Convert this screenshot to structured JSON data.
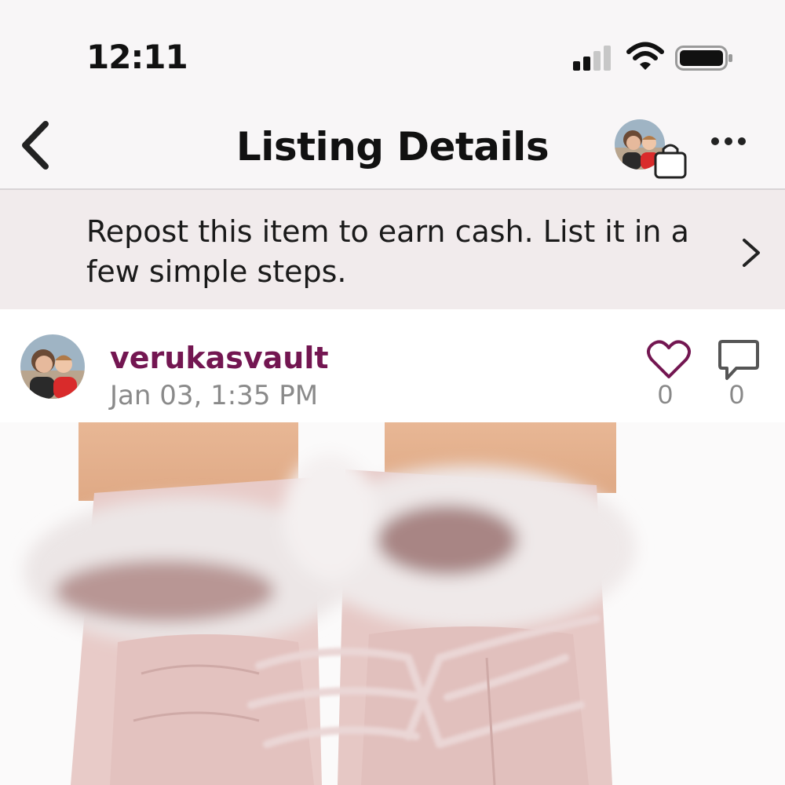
{
  "status_bar": {
    "time": "12:11"
  },
  "nav": {
    "title": "Listing Details"
  },
  "banner": {
    "text": "Repost this item to earn cash. List it in a few simple steps."
  },
  "post": {
    "username": "verukasvault",
    "timestamp": "Jan 03, 1:35 PM",
    "likes": "0",
    "comments": "0"
  },
  "colors": {
    "accent": "#731651",
    "banner_bg": "#f1ebec",
    "bar_bg": "#f8f6f7"
  },
  "icons": [
    "signal-icon",
    "wifi-icon",
    "battery-icon",
    "back-chevron-icon",
    "shopping-bag-icon",
    "more-icon",
    "chevron-right-icon",
    "heart-icon",
    "comment-icon"
  ]
}
